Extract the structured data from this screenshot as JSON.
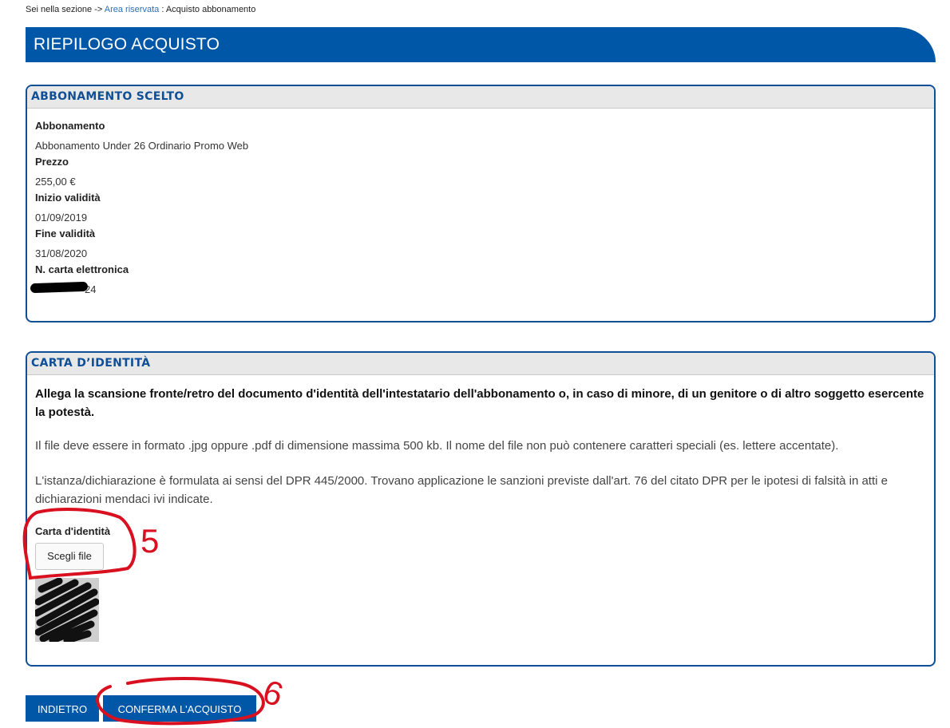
{
  "breadcrumb": {
    "prefix": "Sei nella sezione ->",
    "link": "Area riservata",
    "separator": ":",
    "current": "Acquisto abbonamento"
  },
  "page_title": "RIEPILOGO ACQUISTO",
  "subscription": {
    "header": "ABBONAMENTO SCELTO",
    "fields": [
      {
        "label": "Abbonamento",
        "value": "Abbonamento Under 26 Ordinario Promo Web"
      },
      {
        "label": "Prezzo",
        "value": "255,00 €"
      },
      {
        "label": "Inizio validità",
        "value": "01/09/2019"
      },
      {
        "label": "Fine validità",
        "value": "31/08/2020"
      },
      {
        "label": "N. carta elettronica",
        "value": "24"
      }
    ]
  },
  "identity": {
    "header": "CARTA D’IDENTITÀ",
    "intro": "Allega la scansione fronte/retro del documento d'identità dell'intestatario dell'abbonamento o, in caso di minore, di un genitore o di altro soggetto esercente la potestà.",
    "format_note": "Il file deve essere in formato .jpg oppure .pdf di dimensione massima 500 kb. Il nome del file non può contenere caratteri speciali (es. lettere accentate).",
    "legal_note": "L'istanza/dichiarazione è formulata ai sensi del DPR 445/2000. Trovano applicazione le sanzioni previste dall'art. 76 del citato DPR per le ipotesi di falsità in atti e dichiarazioni mendaci ivi indicate.",
    "file_label": "Carta d'identità",
    "choose_file": "Scegli file"
  },
  "actions": {
    "back": "INDIETRO",
    "confirm": "CONFERMA L'ACQUISTO"
  },
  "annotations": {
    "mark_5": "5",
    "mark_6": "6"
  },
  "colors": {
    "brand_blue": "#0057a7",
    "panel_border": "#0f4f96",
    "annotation_red": "#d8101f"
  }
}
